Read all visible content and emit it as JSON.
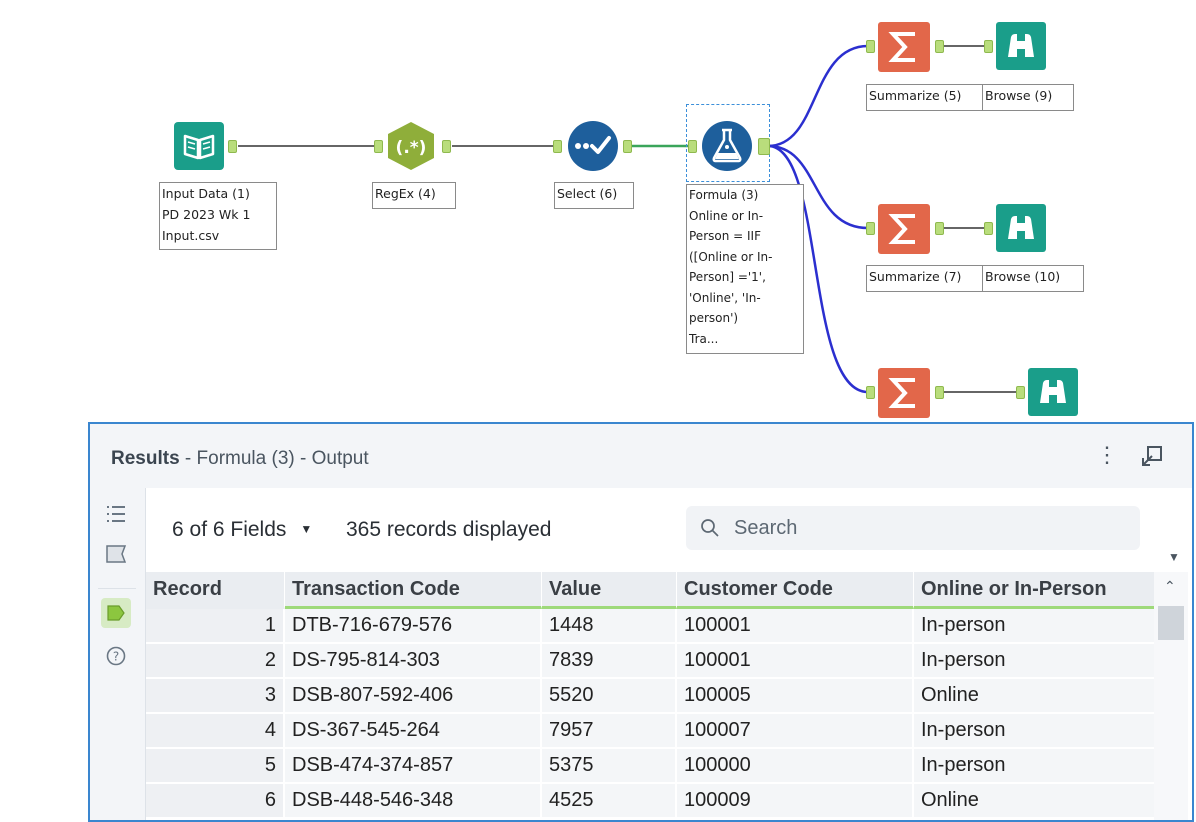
{
  "workflow": {
    "labels": {
      "input": [
        "Input Data (1)",
        "PD 2023 Wk 1",
        "Input.csv"
      ],
      "regex": "RegEx (4)",
      "select": "Select (6)",
      "formula": [
        "Formula (3)",
        "Online or In-",
        "Person = IIF",
        "([Online or In-",
        "Person] ='1',",
        "'Online', 'In-",
        "person')",
        "Tra..."
      ],
      "summarize5": "Summarize (5)",
      "browse9": "Browse (9)",
      "summarize7": "Summarize (7)",
      "browse10": "Browse (10)"
    },
    "icons": {
      "input": "book-icon",
      "regex": "regex-icon",
      "select": "select-check-icon",
      "formula": "flask-icon",
      "summarize": "sigma-icon",
      "browse": "binoculars-icon"
    },
    "colors": {
      "input": "#1a9e8a",
      "regex": "#8fae3a",
      "select": "#1e5f9c",
      "formula": "#1e5f9c",
      "summarize": "#e2674a",
      "browse": "#1a9e8a",
      "connection": "#2b2fcf"
    }
  },
  "results": {
    "title_bold": "Results",
    "title_rest": " - Formula (3) - Output",
    "fields_label": "6 of 6 Fields",
    "records_label": "365 records displayed",
    "search_placeholder": "Search",
    "columns": [
      "Record",
      "Transaction Code",
      "Value",
      "Customer Code",
      "Online or In-Person"
    ],
    "rows": [
      [
        "1",
        "DTB-716-679-576",
        "1448",
        "100001",
        "In-person"
      ],
      [
        "2",
        "DS-795-814-303",
        "7839",
        "100001",
        "In-person"
      ],
      [
        "3",
        "DSB-807-592-406",
        "5520",
        "100005",
        "Online"
      ],
      [
        "4",
        "DS-367-545-264",
        "7957",
        "100007",
        "In-person"
      ],
      [
        "5",
        "DSB-474-374-857",
        "5375",
        "100000",
        "In-person"
      ],
      [
        "6",
        "DSB-448-546-348",
        "4525",
        "100009",
        "Online"
      ]
    ]
  }
}
